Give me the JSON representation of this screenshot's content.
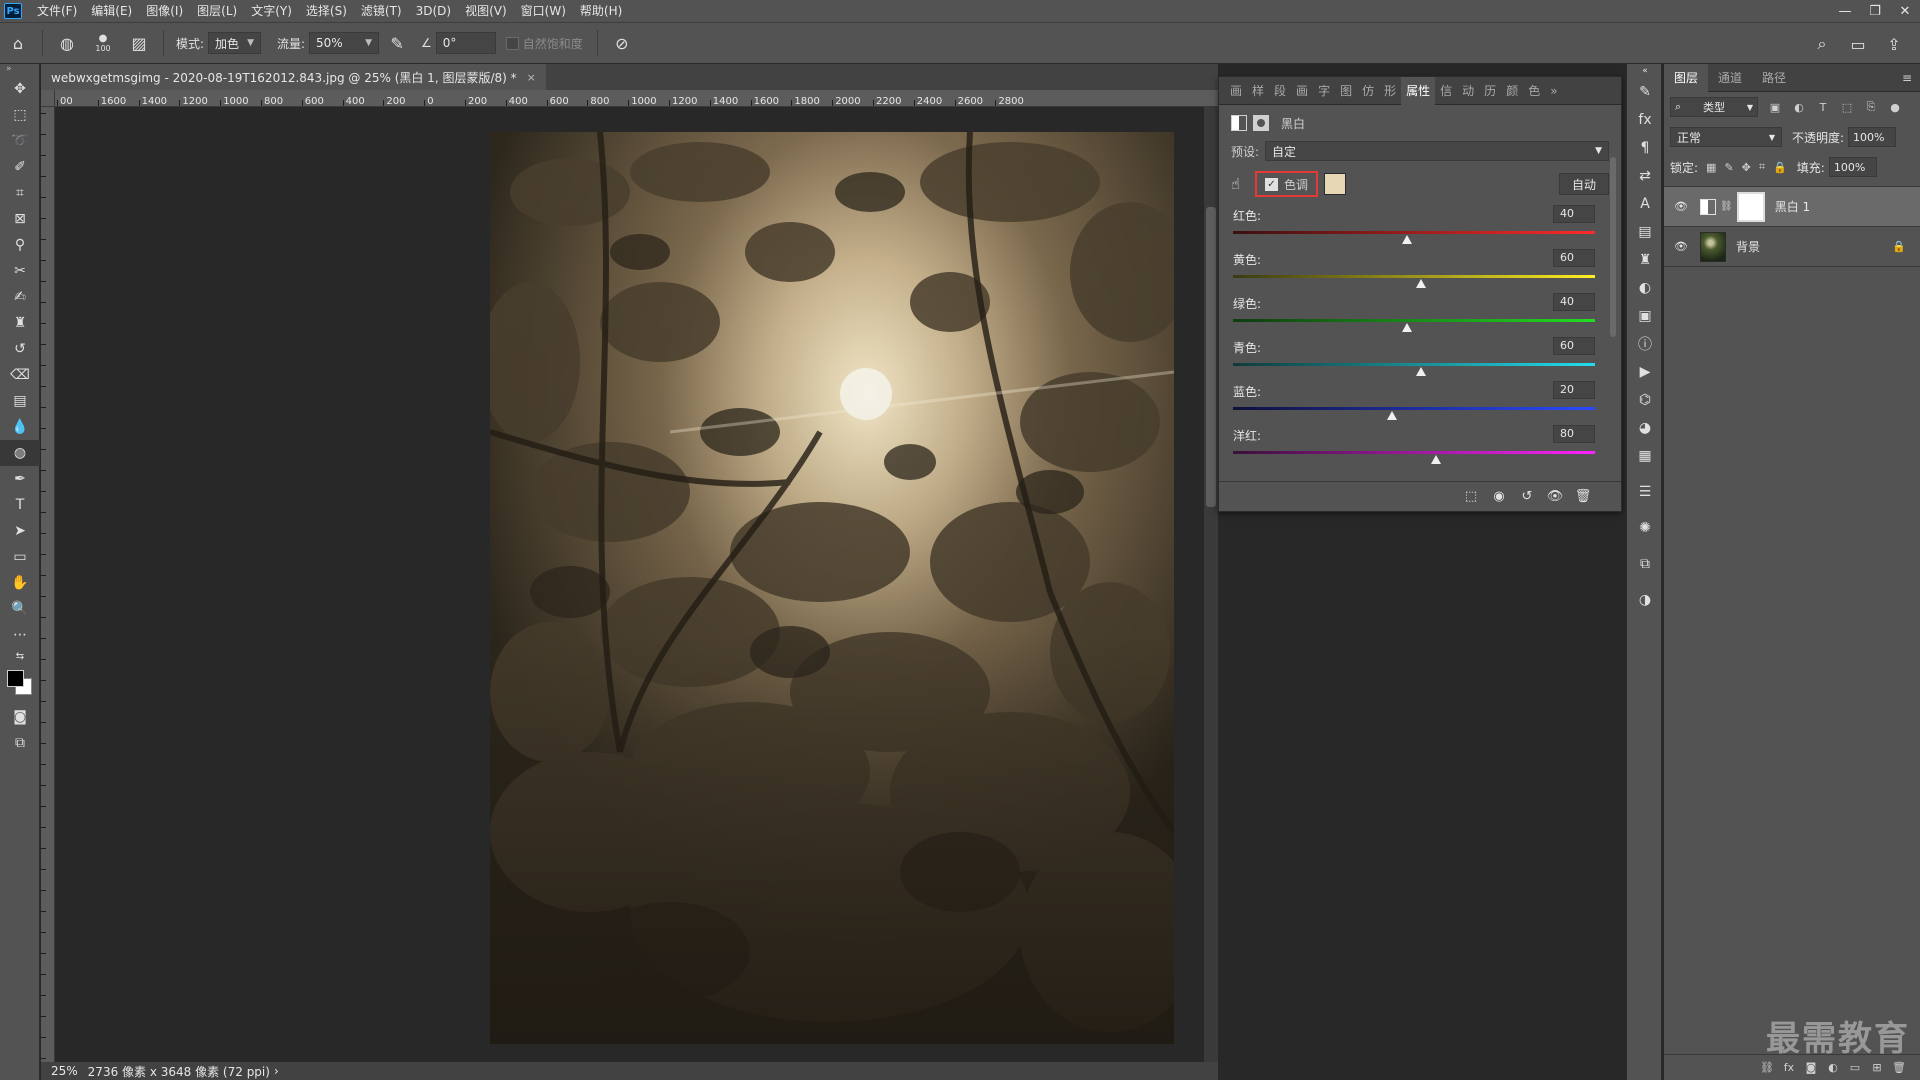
{
  "menubar": {
    "logo": "Ps",
    "items": [
      "文件(F)",
      "编辑(E)",
      "图像(I)",
      "图层(L)",
      "文字(Y)",
      "选择(S)",
      "滤镜(T)",
      "3D(D)",
      "视图(V)",
      "窗口(W)",
      "帮助(H)"
    ],
    "window_buttons": [
      "—",
      "❐",
      "✕"
    ]
  },
  "options": {
    "brush_size": "100",
    "mode_label": "模式:",
    "mode_value": "加色",
    "flow_label": "流量:",
    "flow_value": "50%",
    "angle_value": "0°",
    "vibrance_label": "自然饱和度"
  },
  "document": {
    "tab_title": "webwxgetmsgimg - 2020-08-19T162012.843.jpg @ 25% (黑白 1, 图层蒙版/8) *",
    "tab_close": "×",
    "ruler_top_labels": [
      "00",
      "1600",
      "1400",
      "1200",
      "1000",
      "800",
      "600",
      "400",
      "200",
      "0",
      "200",
      "400",
      "600",
      "800",
      "1000",
      "1200",
      "1400",
      "1600",
      "1800",
      "2000",
      "2200",
      "2400",
      "2600",
      "2800"
    ],
    "status_zoom": "25%",
    "status_info": "2736 像素 x 3648 像素 (72 ppi)",
    "status_arrow": "›"
  },
  "properties": {
    "tabs": [
      "画",
      "样",
      "段",
      "画",
      "字",
      "图",
      "仿",
      "形",
      "属性",
      "信",
      "动",
      "历",
      "颜",
      "色"
    ],
    "tab_overflow": "»",
    "active_tab": "属性",
    "adjustment_name": "黑白",
    "preset_label": "预设:",
    "preset_value": "自定",
    "tint_label": "色调",
    "tint_color": "#e8d7b5",
    "auto_button": "自动",
    "sliders": [
      {
        "label": "红色:",
        "value": "40",
        "gradient": "linear-gradient(90deg,#3a1010,#ff2a2a)"
      },
      {
        "label": "黄色:",
        "value": "60",
        "gradient": "linear-gradient(90deg,#3a3a10,#ffee22)"
      },
      {
        "label": "绿色:",
        "value": "40",
        "gradient": "linear-gradient(90deg,#103a10,#22dd22)"
      },
      {
        "label": "青色:",
        "value": "60",
        "gradient": "linear-gradient(90deg,#103a3a,#22ddee)"
      },
      {
        "label": "蓝色:",
        "value": "20",
        "gradient": "linear-gradient(90deg,#10103a,#2a4aff)"
      },
      {
        "label": "洋红:",
        "value": "80",
        "gradient": "linear-gradient(90deg,#3a103a,#ff22ff)"
      }
    ]
  },
  "layers": {
    "tabs": [
      "图层",
      "通道",
      "路径"
    ],
    "active_tab": "图层",
    "filter_label": "类型",
    "blend_mode": "正常",
    "opacity_label": "不透明度:",
    "opacity_value": "100%",
    "lock_label": "锁定:",
    "fill_label": "填充:",
    "fill_value": "100%",
    "items": [
      {
        "name": "黑白 1",
        "selected": true
      },
      {
        "name": "背景",
        "selected": false
      }
    ]
  },
  "watermark": "最需教育"
}
